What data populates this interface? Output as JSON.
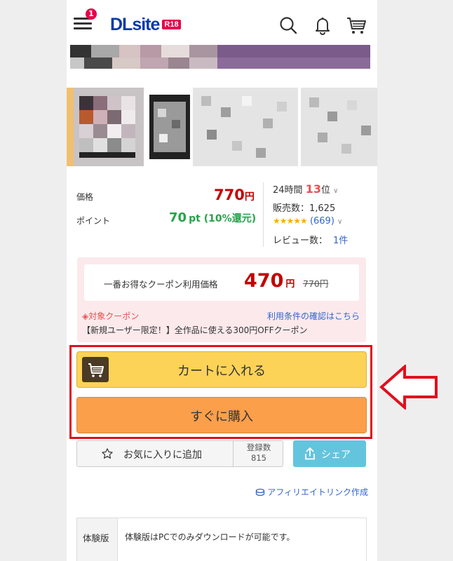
{
  "header": {
    "menu_badge": "1",
    "logo_text": "DLsite",
    "logo_tag": "R18"
  },
  "price": {
    "price_label": "価格",
    "price_value": "770",
    "price_unit": "円",
    "point_label": "ポイント",
    "point_value": "70",
    "point_unit": "pt",
    "point_rate": "(10%還元)"
  },
  "stats": {
    "rank_prefix": "24時間",
    "rank_value": "13",
    "rank_suffix": "位",
    "sales_label": "販売数：1,625",
    "rating_stars": "★★★★★",
    "rating_count": "(669)",
    "reviews_label": "レビュー数：",
    "reviews_count": "1件"
  },
  "coupon": {
    "best_label": "一番お得なクーポン利用価格",
    "best_price": "470",
    "best_unit": "円",
    "original_price": "770円",
    "target_link": "対象クーポン",
    "terms_link": "利用条件の確認はこちら",
    "description": "【新規ユーザー限定！】全作品に使える300円OFFクーポン"
  },
  "actions": {
    "cart_label": "カートに入れる",
    "buy_label": "すぐに購入",
    "favorite_label": "お気に入りに追加",
    "reg_label": "登録数",
    "reg_count": "815",
    "share_label": "シェア",
    "affiliate_label": "アフィリエイトリンク作成"
  },
  "trial": {
    "header": "体験版",
    "text": "体験版はPCでのみダウンロードが可能です。"
  },
  "colors": {
    "accent_red": "#c40000",
    "point_green": "#27a24a",
    "cart_yellow": "#fcd357",
    "buy_orange": "#fb9f4a",
    "share_blue": "#64c4de",
    "highlight_red": "#e0101d"
  }
}
